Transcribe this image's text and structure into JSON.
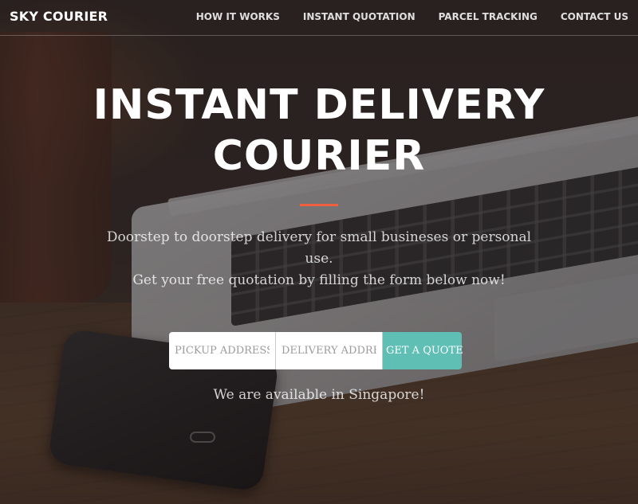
{
  "navbar": {
    "brand": "SKY COURIER",
    "links": [
      {
        "label": "HOW IT WORKS"
      },
      {
        "label": "INSTANT QUOTATION"
      },
      {
        "label": "PARCEL TRACKING"
      },
      {
        "label": "CONTACT US"
      }
    ]
  },
  "hero": {
    "title_line1": "INSTANT DELIVERY",
    "title_line2": "COURIER",
    "subtitle_line1": "Doorstep to doorstep delivery for small busineses or personal use.",
    "subtitle_line2": "Get your free quotation by filling the form below now!"
  },
  "quote_form": {
    "pickup_placeholder": "PICKUP ADDRESS",
    "pickup_value": "",
    "delivery_placeholder": "DELIVERY ADDRESS",
    "delivery_value": "",
    "button_label": "GET A QUOTE"
  },
  "availability": "We are available in Singapore!",
  "colors": {
    "accent_divider": "#f05f40",
    "button": "#5fbfb5",
    "text": "#ffffff"
  }
}
